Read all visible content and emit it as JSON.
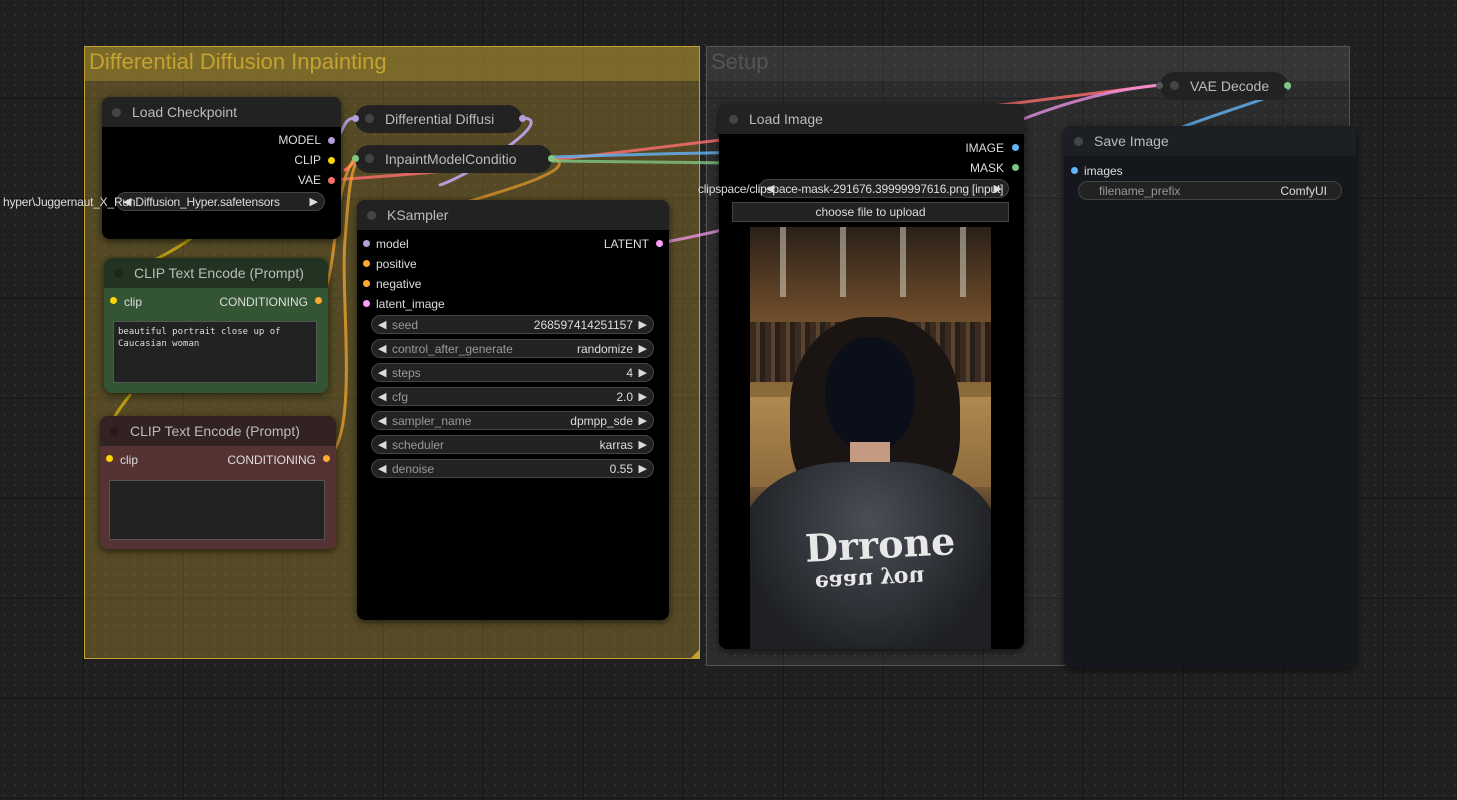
{
  "groups": {
    "inpaint": {
      "title": "Differential Diffusion Inpainting",
      "color": "#c3a232"
    },
    "setup": {
      "title": "Setup",
      "color": "#888888"
    }
  },
  "nodes": {
    "load_checkpoint": {
      "title": "Load Checkpoint",
      "outputs": [
        "MODEL",
        "CLIP",
        "VAE"
      ],
      "ckpt_name": "hyper\\Juggernaut_X_RunDiffusion_Hyper.safetensors"
    },
    "differential_diffusion": {
      "title": "Differential Diffusi"
    },
    "inpaint_model_conditioning": {
      "title": "InpaintModelConditio"
    },
    "clip_positive": {
      "title": "CLIP Text Encode (Prompt)",
      "input": "clip",
      "output": "CONDITIONING",
      "text": "beautiful portrait close up of Caucasian woman"
    },
    "clip_negative": {
      "title": "CLIP Text Encode (Prompt)",
      "input": "clip",
      "output": "CONDITIONING",
      "text": ""
    },
    "ksampler": {
      "title": "KSampler",
      "inputs": [
        "model",
        "positive",
        "negative",
        "latent_image"
      ],
      "output": "LATENT",
      "widgets": [
        {
          "label": "seed",
          "value": "268597414251157"
        },
        {
          "label": "control_after_generate",
          "value": "randomize"
        },
        {
          "label": "steps",
          "value": "4"
        },
        {
          "label": "cfg",
          "value": "2.0"
        },
        {
          "label": "sampler_name",
          "value": "dpmpp_sde"
        },
        {
          "label": "scheduler",
          "value": "karras"
        },
        {
          "label": "denoise",
          "value": "0.55"
        }
      ]
    },
    "load_image": {
      "title": "Load Image",
      "outputs": [
        "IMAGE",
        "MASK"
      ],
      "image": "clipspace/clipspace-mask-291676.39999997616.png [input]",
      "upload_label": "choose file to upload",
      "preview_text_line1": "Drrone",
      "preview_text_line2": "eaau you"
    },
    "vae_decode": {
      "title": "VAE Decode"
    },
    "save_image": {
      "title": "Save Image",
      "input": "images",
      "filename_prefix_label": "filename_prefix",
      "filename_prefix": "ComfyUI"
    }
  },
  "colors": {
    "model": "#b39ddb",
    "clip": "#ffd500",
    "vae": "#ff6e6e",
    "conditioning": "#ffa931",
    "latent": "#ff9cf9",
    "image": "#64b5f6",
    "mask": "#81c784"
  }
}
